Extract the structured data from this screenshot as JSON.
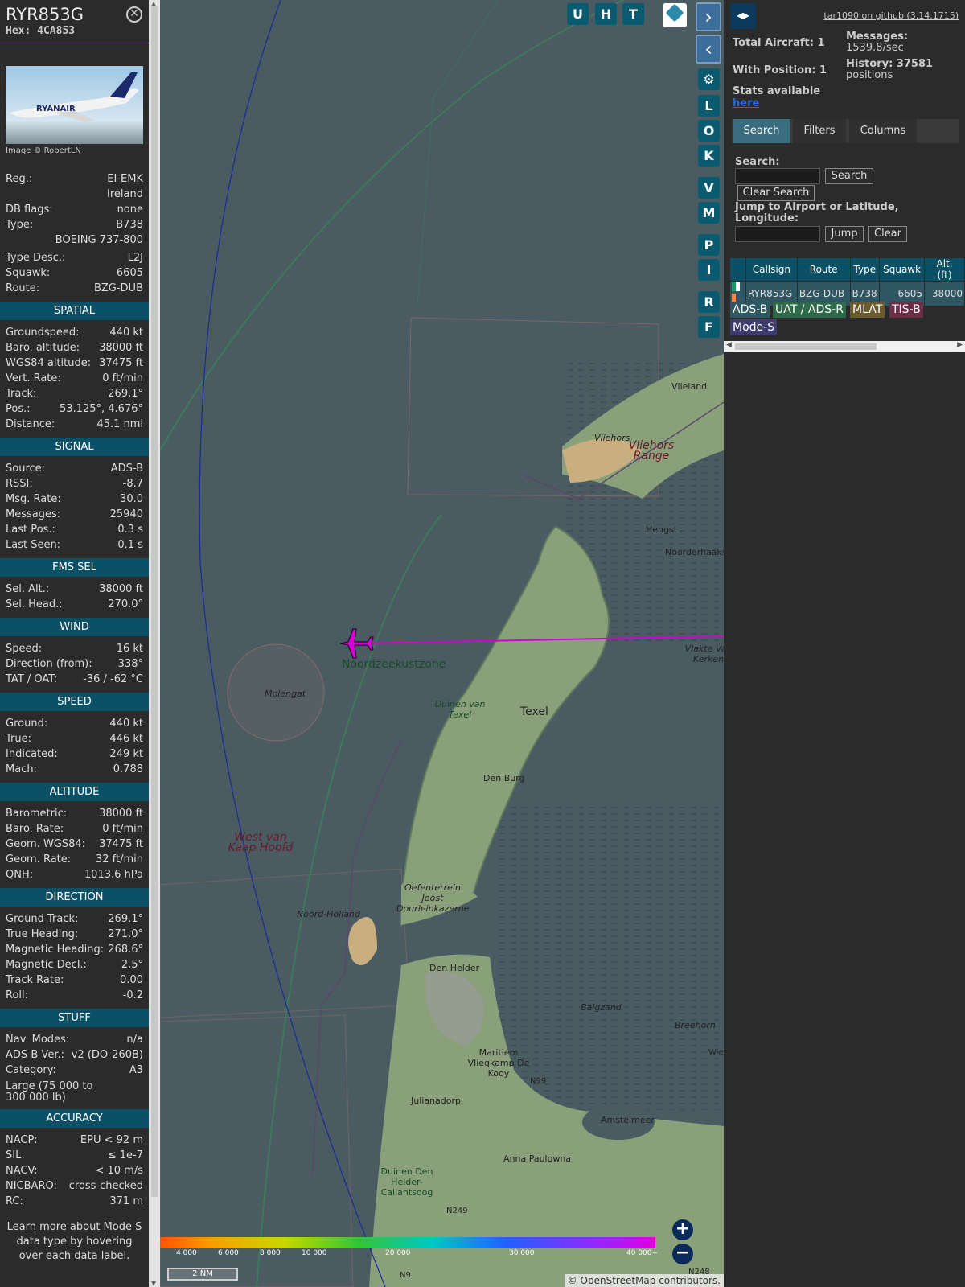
{
  "aircraft": {
    "callsign": "RYR853G",
    "hex": "Hex: 4CA853",
    "photo_credit": "Image © RobertLN",
    "photo_livery": "RYANAIR"
  },
  "details": [
    {
      "label": "Reg.:",
      "value": "EI-EMK"
    },
    {
      "label": "",
      "value": "Ireland"
    },
    {
      "label": "DB flags:",
      "value": "none"
    },
    {
      "label": "Type:",
      "value": "B738"
    },
    {
      "label": "",
      "value": "BOEING 737-800"
    },
    {
      "label": "Type Desc.:",
      "value": "L2J"
    },
    {
      "label": "Squawk:",
      "value": "6605"
    },
    {
      "label": "Route:",
      "value": "BZG-DUB"
    }
  ],
  "sections": {
    "spatial": {
      "title": "SPATIAL",
      "rows": [
        [
          "Groundspeed:",
          "440 kt"
        ],
        [
          "Baro. altitude:",
          "38000 ft"
        ],
        [
          "WGS84 altitude:",
          "37475 ft"
        ],
        [
          "Vert. Rate:",
          "0 ft/min"
        ],
        [
          "Track:",
          "269.1°"
        ],
        [
          "Pos.:",
          "53.125°, 4.676°"
        ],
        [
          "Distance:",
          "45.1 nmi"
        ]
      ]
    },
    "signal": {
      "title": "SIGNAL",
      "rows": [
        [
          "Source:",
          "ADS-B"
        ],
        [
          "RSSI:",
          "-8.7"
        ],
        [
          "Msg. Rate:",
          "30.0"
        ],
        [
          "Messages:",
          "25940"
        ],
        [
          "Last Pos.:",
          "0.3 s"
        ],
        [
          "Last Seen:",
          "0.1 s"
        ]
      ]
    },
    "fms": {
      "title": "FMS SEL",
      "rows": [
        [
          "Sel. Alt.:",
          "38000 ft"
        ],
        [
          "Sel. Head.:",
          "270.0°"
        ]
      ]
    },
    "wind": {
      "title": "WIND",
      "rows": [
        [
          "Speed:",
          "16 kt"
        ],
        [
          "Direction (from):",
          "338°"
        ],
        [
          "TAT / OAT:",
          "-36 / -62 °C"
        ]
      ]
    },
    "speed": {
      "title": "SPEED",
      "rows": [
        [
          "Ground:",
          "440 kt"
        ],
        [
          "True:",
          "446 kt"
        ],
        [
          "Indicated:",
          "249 kt"
        ],
        [
          "Mach:",
          "0.788"
        ]
      ]
    },
    "altitude": {
      "title": "ALTITUDE",
      "rows": [
        [
          "Barometric:",
          "38000 ft"
        ],
        [
          "Baro. Rate:",
          "0 ft/min"
        ],
        [
          "Geom. WGS84:",
          "37475 ft"
        ],
        [
          "Geom. Rate:",
          "32 ft/min"
        ],
        [
          "QNH:",
          "1013.6 hPa"
        ]
      ]
    },
    "direction": {
      "title": "DIRECTION",
      "rows": [
        [
          "Ground Track:",
          "269.1°"
        ],
        [
          "True Heading:",
          "271.0°"
        ],
        [
          "Magnetic Heading:",
          "268.6°"
        ],
        [
          "Magnetic Decl.:",
          "2.5°"
        ],
        [
          "Track Rate:",
          "0.00"
        ],
        [
          "Roll:",
          "-0.2"
        ]
      ]
    },
    "stuff": {
      "title": "STUFF",
      "rows": [
        [
          "Nav. Modes:",
          "n/a"
        ],
        [
          "ADS-B Ver.:",
          "v2 (DO-260B)"
        ],
        [
          "Category:",
          "A3"
        ]
      ],
      "category_desc": "Large (75 000 to 300 000 lb)"
    },
    "accuracy": {
      "title": "ACCURACY",
      "rows": [
        [
          "NACP:",
          "EPU < 92 m"
        ],
        [
          "SIL:",
          "≤ 1e-7"
        ],
        [
          "NACV:",
          "< 10 m/s"
        ],
        [
          "NICBARO:",
          "cross-checked"
        ],
        [
          "RC:",
          "371 m"
        ]
      ]
    }
  },
  "learn_more": "Learn more about Mode S data type by hovering over each data label.",
  "map": {
    "buttons": [
      "U",
      "H",
      "T"
    ],
    "side_buttons": [
      "L",
      "O",
      "K",
      "V",
      "M",
      "P",
      "I",
      "R",
      "F"
    ],
    "labels": [
      "Vlieland",
      "Vliehors",
      "Vliehors Range",
      "Hengst",
      "Noorderhaaks",
      "Vlakte Van Kerken",
      "Noordzeekustzone",
      "Molengat",
      "Duinen van Texel",
      "Texel",
      "Den Burg",
      "West van Kaap Hoofd",
      "Oefenterrein Joost Dourleinkazerne",
      "Noord-Holland",
      "Den Helder",
      "Balgzand",
      "Breehorn",
      "Maritiem Vliegkamp De Kooy",
      "Julianadorp",
      "N99",
      "Amstelmeer",
      "Anna Paulowna",
      "Duinen Den Helder-Callantsoog",
      "N249",
      "N9",
      "N248",
      "Wie"
    ],
    "colorbar_labels": [
      "4 000",
      "6 000",
      "8 000",
      "10 000",
      "20 000",
      "30 000",
      "40 000+"
    ],
    "scale": "2 NM",
    "attribution": "© OpenStreetMap contributors.",
    "zoom_in": "+",
    "zoom_out": "−",
    "track_color": "#d400d4"
  },
  "panel": {
    "version_link": "tar1090 on github (3.14.1715)",
    "total_aircraft": "Total Aircraft: 1",
    "with_position": "With Position: 1",
    "messages_label": "Messages:",
    "messages_value": "1539.8/sec",
    "history_label": "History: 37581",
    "history_value": "positions",
    "stats_label": "Stats available",
    "stats_link": "here",
    "tabs": [
      "Search",
      "Filters",
      "Columns"
    ],
    "search_label": "Search:",
    "search_btn": "Search",
    "clear_search_btn": "Clear Search",
    "jump_label": "Jump to Airport or Latitude, Longitude:",
    "jump_btn": "Jump",
    "clear_btn": "Clear",
    "table_headers": [
      "Callsign",
      "Route",
      "Type",
      "Squawk",
      "Alt. (ft)"
    ],
    "table_rows": [
      {
        "callsign": "RYR853G",
        "route": "BZG-DUB",
        "type": "B738",
        "squawk": "6605",
        "alt": "38000"
      }
    ],
    "badges": [
      {
        "text": "ADS-B",
        "color": "#2e5663"
      },
      {
        "text": "UAT / ADS-R",
        "color": "#2e6a4a"
      },
      {
        "text": "MLAT",
        "color": "#6b5a2e"
      },
      {
        "text": "TIS-B",
        "color": "#6a2e46"
      },
      {
        "text": "Mode-S",
        "color": "#3c3c6e"
      }
    ]
  }
}
